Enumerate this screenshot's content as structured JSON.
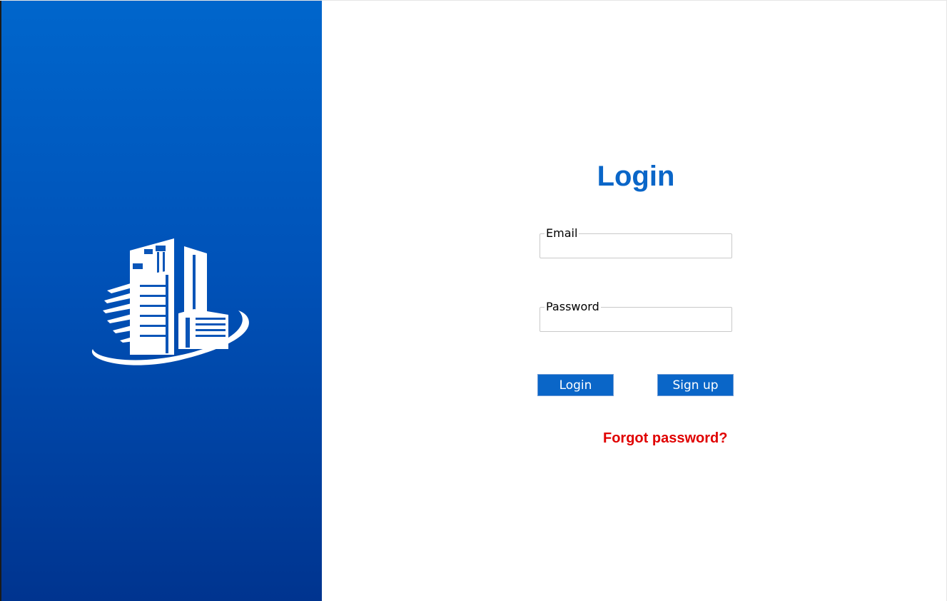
{
  "brand": {
    "logo_icon": "city-building-icon",
    "gradient_top": "#0066cc",
    "gradient_bottom": "#00348f"
  },
  "login_form": {
    "title": "Login",
    "title_color": "#0a66c8",
    "email": {
      "label": "Email",
      "value": ""
    },
    "password": {
      "label": "Password",
      "value": ""
    },
    "login_button_label": "Login",
    "signup_button_label": "Sign up",
    "forgot_password_label": "Forgot password?",
    "forgot_color": "#e00000"
  }
}
